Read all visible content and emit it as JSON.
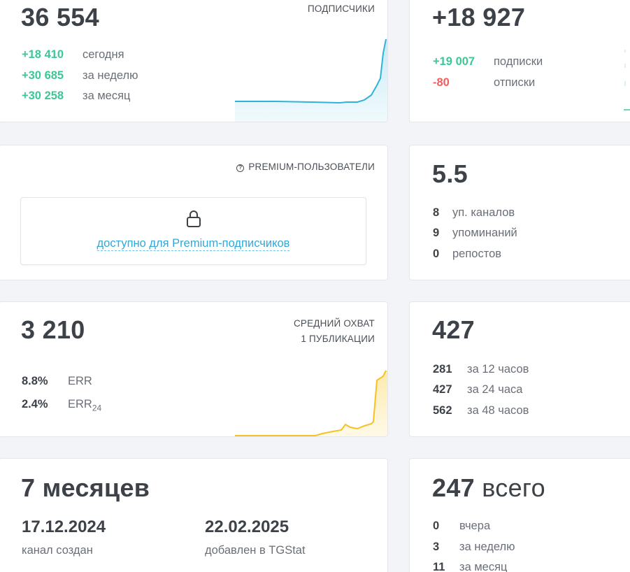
{
  "subscribers": {
    "total": "36 554",
    "corner_label": "ПОДПИСЧИКИ",
    "rows": [
      {
        "value": "+18 410",
        "label": "сегодня"
      },
      {
        "value": "+30 685",
        "label": "за неделю"
      },
      {
        "value": "+30 258",
        "label": "за месяц"
      }
    ],
    "line_color": "#2fb3d9"
  },
  "growth": {
    "total": "+18 927",
    "rows": [
      {
        "value": "+19 007",
        "label": "подписки"
      },
      {
        "value": "-80",
        "label": "отписки"
      }
    ]
  },
  "premium": {
    "corner_label": "PREMIUM-ПОЛЬЗОВАТЕЛИ",
    "help_icon_glyph": "?",
    "lock_text": "доступно для Premium-подписчиков",
    "link_color": "#30a8d8"
  },
  "citation": {
    "total": "5.5",
    "rows": [
      {
        "value": "8",
        "label": "уп. каналов"
      },
      {
        "value": "9",
        "label": "упоминаний"
      },
      {
        "value": "0",
        "label": "репостов"
      }
    ]
  },
  "reach": {
    "total": "3 210",
    "corner_line1": "СРЕДНИЙ ОХВАТ",
    "corner_line2": "1 ПУБЛИКАЦИИ",
    "rows": [
      {
        "value": "8.8%",
        "label": "ERR",
        "sub": ""
      },
      {
        "value": "2.4%",
        "label": "ERR",
        "sub": "24"
      }
    ],
    "line_color": "#f5c226"
  },
  "views": {
    "total": "427",
    "rows": [
      {
        "value": "281",
        "label": "за 12 часов"
      },
      {
        "value": "427",
        "label": "за 24 часа"
      },
      {
        "value": "562",
        "label": "за 48 часов"
      }
    ]
  },
  "age": {
    "total": "7 месяцев",
    "created_date": "17.12.2024",
    "created_label": "канал создан",
    "added_date": "22.02.2025",
    "added_label": "добавлен в TGStat"
  },
  "mentions": {
    "total_number": "247",
    "total_word": "всего",
    "rows": [
      {
        "value": "0",
        "label": "вчера"
      },
      {
        "value": "3",
        "label": "за неделю"
      },
      {
        "value": "11",
        "label": "за месяц"
      }
    ]
  }
}
